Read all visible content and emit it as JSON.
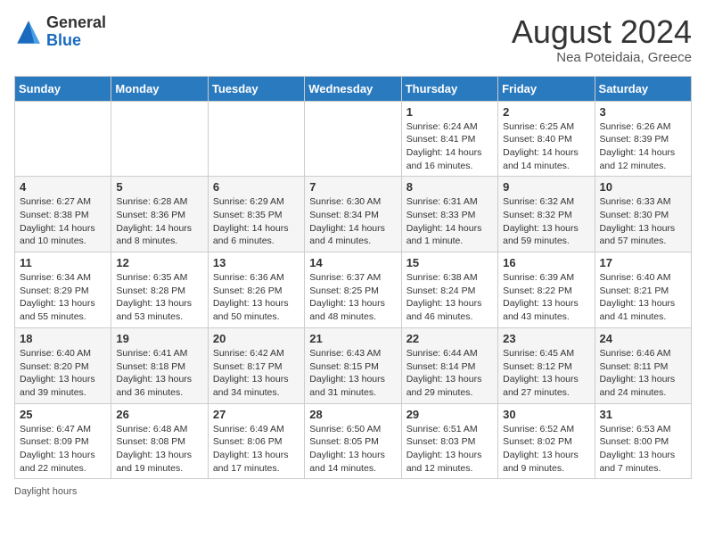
{
  "header": {
    "logo": {
      "general": "General",
      "blue": "Blue"
    },
    "month_year": "August 2024",
    "location": "Nea Poteidaia, Greece"
  },
  "days_of_week": [
    "Sunday",
    "Monday",
    "Tuesday",
    "Wednesday",
    "Thursday",
    "Friday",
    "Saturday"
  ],
  "weeks": [
    [
      {
        "day": "",
        "info": ""
      },
      {
        "day": "",
        "info": ""
      },
      {
        "day": "",
        "info": ""
      },
      {
        "day": "",
        "info": ""
      },
      {
        "day": "1",
        "info": "Sunrise: 6:24 AM\nSunset: 8:41 PM\nDaylight: 14 hours and 16 minutes."
      },
      {
        "day": "2",
        "info": "Sunrise: 6:25 AM\nSunset: 8:40 PM\nDaylight: 14 hours and 14 minutes."
      },
      {
        "day": "3",
        "info": "Sunrise: 6:26 AM\nSunset: 8:39 PM\nDaylight: 14 hours and 12 minutes."
      }
    ],
    [
      {
        "day": "4",
        "info": "Sunrise: 6:27 AM\nSunset: 8:38 PM\nDaylight: 14 hours and 10 minutes."
      },
      {
        "day": "5",
        "info": "Sunrise: 6:28 AM\nSunset: 8:36 PM\nDaylight: 14 hours and 8 minutes."
      },
      {
        "day": "6",
        "info": "Sunrise: 6:29 AM\nSunset: 8:35 PM\nDaylight: 14 hours and 6 minutes."
      },
      {
        "day": "7",
        "info": "Sunrise: 6:30 AM\nSunset: 8:34 PM\nDaylight: 14 hours and 4 minutes."
      },
      {
        "day": "8",
        "info": "Sunrise: 6:31 AM\nSunset: 8:33 PM\nDaylight: 14 hours and 1 minute."
      },
      {
        "day": "9",
        "info": "Sunrise: 6:32 AM\nSunset: 8:32 PM\nDaylight: 13 hours and 59 minutes."
      },
      {
        "day": "10",
        "info": "Sunrise: 6:33 AM\nSunset: 8:30 PM\nDaylight: 13 hours and 57 minutes."
      }
    ],
    [
      {
        "day": "11",
        "info": "Sunrise: 6:34 AM\nSunset: 8:29 PM\nDaylight: 13 hours and 55 minutes."
      },
      {
        "day": "12",
        "info": "Sunrise: 6:35 AM\nSunset: 8:28 PM\nDaylight: 13 hours and 53 minutes."
      },
      {
        "day": "13",
        "info": "Sunrise: 6:36 AM\nSunset: 8:26 PM\nDaylight: 13 hours and 50 minutes."
      },
      {
        "day": "14",
        "info": "Sunrise: 6:37 AM\nSunset: 8:25 PM\nDaylight: 13 hours and 48 minutes."
      },
      {
        "day": "15",
        "info": "Sunrise: 6:38 AM\nSunset: 8:24 PM\nDaylight: 13 hours and 46 minutes."
      },
      {
        "day": "16",
        "info": "Sunrise: 6:39 AM\nSunset: 8:22 PM\nDaylight: 13 hours and 43 minutes."
      },
      {
        "day": "17",
        "info": "Sunrise: 6:40 AM\nSunset: 8:21 PM\nDaylight: 13 hours and 41 minutes."
      }
    ],
    [
      {
        "day": "18",
        "info": "Sunrise: 6:40 AM\nSunset: 8:20 PM\nDaylight: 13 hours and 39 minutes."
      },
      {
        "day": "19",
        "info": "Sunrise: 6:41 AM\nSunset: 8:18 PM\nDaylight: 13 hours and 36 minutes."
      },
      {
        "day": "20",
        "info": "Sunrise: 6:42 AM\nSunset: 8:17 PM\nDaylight: 13 hours and 34 minutes."
      },
      {
        "day": "21",
        "info": "Sunrise: 6:43 AM\nSunset: 8:15 PM\nDaylight: 13 hours and 31 minutes."
      },
      {
        "day": "22",
        "info": "Sunrise: 6:44 AM\nSunset: 8:14 PM\nDaylight: 13 hours and 29 minutes."
      },
      {
        "day": "23",
        "info": "Sunrise: 6:45 AM\nSunset: 8:12 PM\nDaylight: 13 hours and 27 minutes."
      },
      {
        "day": "24",
        "info": "Sunrise: 6:46 AM\nSunset: 8:11 PM\nDaylight: 13 hours and 24 minutes."
      }
    ],
    [
      {
        "day": "25",
        "info": "Sunrise: 6:47 AM\nSunset: 8:09 PM\nDaylight: 13 hours and 22 minutes."
      },
      {
        "day": "26",
        "info": "Sunrise: 6:48 AM\nSunset: 8:08 PM\nDaylight: 13 hours and 19 minutes."
      },
      {
        "day": "27",
        "info": "Sunrise: 6:49 AM\nSunset: 8:06 PM\nDaylight: 13 hours and 17 minutes."
      },
      {
        "day": "28",
        "info": "Sunrise: 6:50 AM\nSunset: 8:05 PM\nDaylight: 13 hours and 14 minutes."
      },
      {
        "day": "29",
        "info": "Sunrise: 6:51 AM\nSunset: 8:03 PM\nDaylight: 13 hours and 12 minutes."
      },
      {
        "day": "30",
        "info": "Sunrise: 6:52 AM\nSunset: 8:02 PM\nDaylight: 13 hours and 9 minutes."
      },
      {
        "day": "31",
        "info": "Sunrise: 6:53 AM\nSunset: 8:00 PM\nDaylight: 13 hours and 7 minutes."
      }
    ]
  ],
  "footer": {
    "daylight_label": "Daylight hours"
  }
}
